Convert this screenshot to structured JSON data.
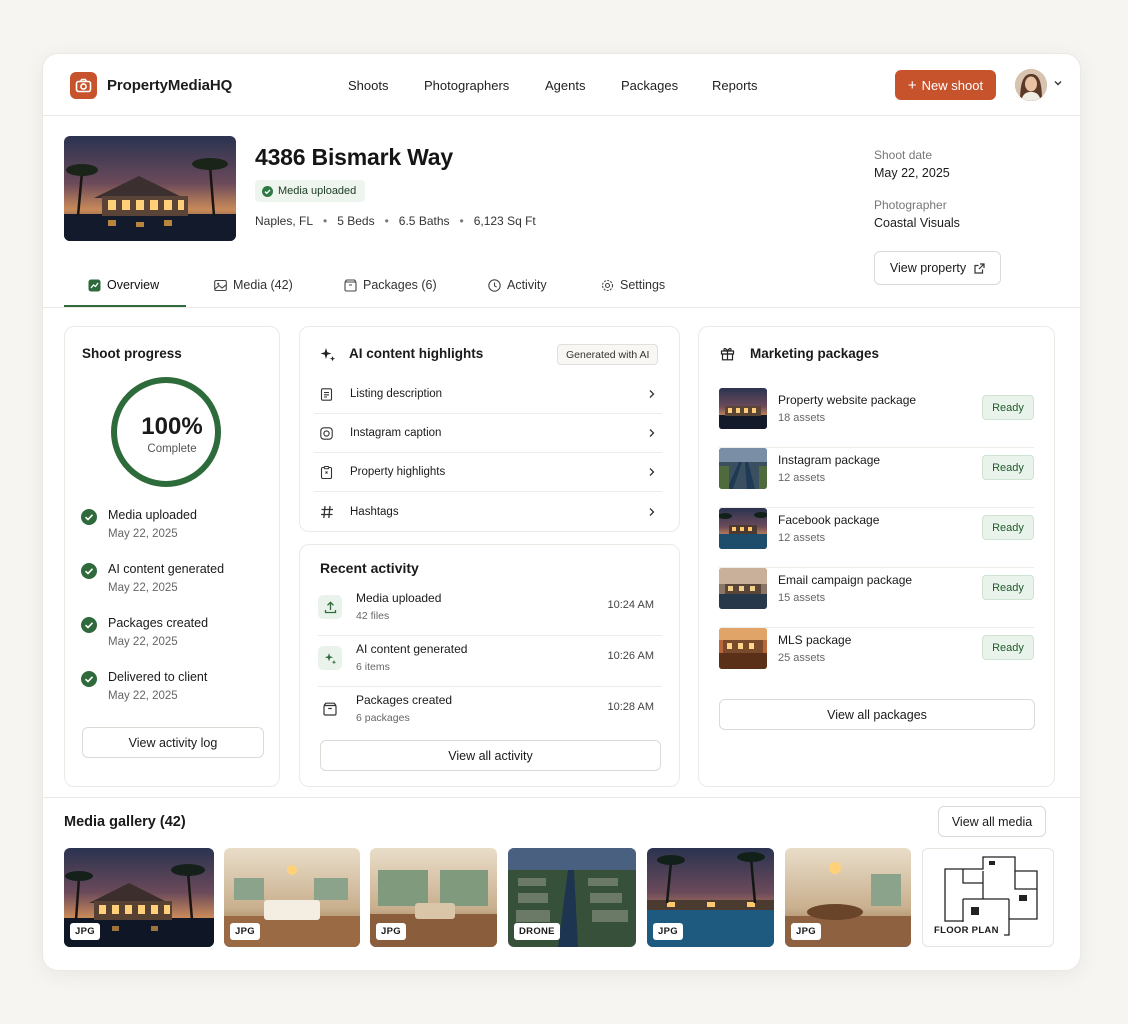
{
  "brand": {
    "name": "PropertyMediaHQ",
    "logo_icon": "camera-icon",
    "accent": "#c7532c"
  },
  "nav": [
    "Shoots",
    "Photographers",
    "Agents",
    "Packages",
    "Reports"
  ],
  "new_shoot_label": "New shoot",
  "property": {
    "address": "4386 Bismark Way",
    "status": "Media uploaded",
    "city": "Naples, FL",
    "beds": "5 Beds",
    "baths": "6.5 Baths",
    "sqft": "6,123 Sq Ft",
    "shoot_date_label": "Shoot date",
    "shoot_date": "May 22, 2025",
    "photographer_label": "Photographer",
    "photographer": "Coastal Visuals",
    "view_property_label": "View property"
  },
  "tabs": [
    {
      "label": "Overview",
      "icon": "overview-icon"
    },
    {
      "label": "Media (42)",
      "icon": "image-icon"
    },
    {
      "label": "Packages (6)",
      "icon": "package-icon"
    },
    {
      "label": "Activity",
      "icon": "clock-icon"
    },
    {
      "label": "Settings",
      "icon": "gear-icon"
    }
  ],
  "progress": {
    "title": "Shoot progress",
    "percent_text": "100%",
    "percent_value": 1.0,
    "complete_label": "Complete",
    "steps": [
      {
        "label": "Media uploaded",
        "date": "May 22, 2025"
      },
      {
        "label": "AI content generated",
        "date": "May 22, 2025"
      },
      {
        "label": "Packages created",
        "date": "May 22, 2025"
      },
      {
        "label": "Delivered to client",
        "date": "May 22, 2025"
      }
    ],
    "button": "View activity log"
  },
  "ai": {
    "title": "AI content highlights",
    "badge": "Generated with AI",
    "items": [
      {
        "label": "Listing description",
        "icon": "document-icon"
      },
      {
        "label": "Instagram caption",
        "icon": "instagram-icon"
      },
      {
        "label": "Property highlights",
        "icon": "clipboard-icon"
      },
      {
        "label": "Hashtags",
        "icon": "hash-icon"
      }
    ]
  },
  "activity": {
    "title": "Recent activity",
    "items": [
      {
        "title": "Media uploaded",
        "sub": "42 files",
        "time": "10:24 AM",
        "icon": "upload-icon"
      },
      {
        "title": "AI content generated",
        "sub": "6 items",
        "time": "10:26 AM",
        "icon": "sparkle-icon"
      },
      {
        "title": "Packages created",
        "sub": "6 packages",
        "time": "10:28 AM",
        "icon": "package-icon"
      }
    ],
    "button": "View all activity"
  },
  "packages": {
    "title": "Marketing packages",
    "items": [
      {
        "name": "Property website package",
        "assets": "18 assets",
        "status": "Ready"
      },
      {
        "name": "Instagram package",
        "assets": "12 assets",
        "status": "Ready"
      },
      {
        "name": "Facebook package",
        "assets": "12 assets",
        "status": "Ready"
      },
      {
        "name": "Email campaign package",
        "assets": "15 assets",
        "status": "Ready"
      },
      {
        "name": "MLS package",
        "assets": "25 assets",
        "status": "Ready"
      }
    ],
    "button": "View all packages"
  },
  "gallery": {
    "title": "Media gallery (42)",
    "button": "View all media",
    "items": [
      {
        "tag": "JPG"
      },
      {
        "tag": "JPG"
      },
      {
        "tag": "JPG"
      },
      {
        "tag": "DRONE"
      },
      {
        "tag": "JPG"
      },
      {
        "tag": "JPG"
      },
      {
        "tag": "FLOOR PLAN"
      }
    ]
  }
}
